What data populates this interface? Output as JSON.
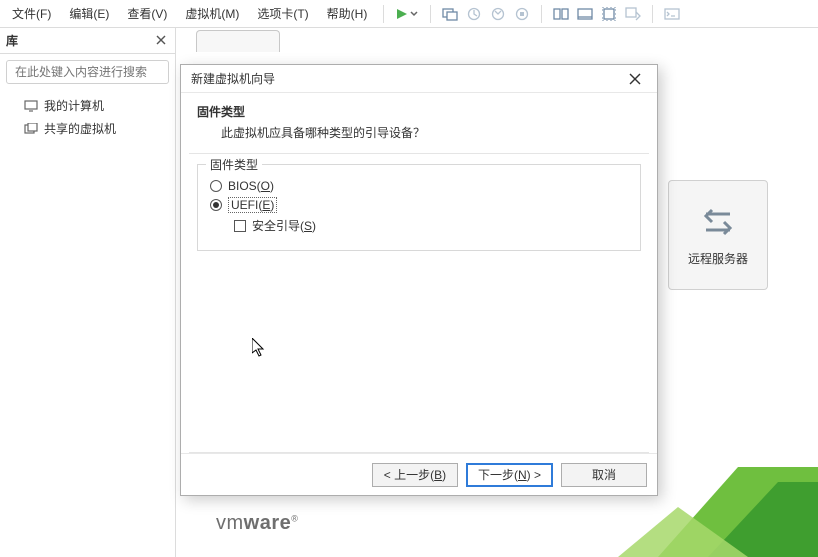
{
  "menubar": {
    "items": [
      {
        "label": "文件(F)"
      },
      {
        "label": "编辑(E)"
      },
      {
        "label": "查看(V)"
      },
      {
        "label": "虚拟机(M)"
      },
      {
        "label": "选项卡(T)"
      },
      {
        "label": "帮助(H)"
      }
    ]
  },
  "sidebar": {
    "title": "库",
    "search_placeholder": "在此处键入内容进行搜索",
    "items": [
      {
        "label": "我的计算机",
        "icon": "monitor"
      },
      {
        "label": "共享的虚拟机",
        "icon": "shared"
      }
    ]
  },
  "side_card": {
    "label": "远程服务器"
  },
  "logo": {
    "thin": "vm",
    "bold": "ware"
  },
  "dialog": {
    "title": "新建虚拟机向导",
    "heading": "固件类型",
    "subheading": "此虚拟机应具备哪种类型的引导设备？",
    "group_label": "固件类型",
    "bios_pre": "BIOS(",
    "bios_u": "O",
    "bios_post": ")",
    "uefi_pre": "UEFI(",
    "uefi_u": "E",
    "uefi_post": ")",
    "secure_pre": "安全引导(",
    "secure_u": "S",
    "secure_post": ")",
    "btn_back_pre": "< 上一步(",
    "btn_back_u": "B",
    "btn_back_post": ")",
    "btn_next_pre": "下一步(",
    "btn_next_u": "N",
    "btn_next_post": ") >",
    "btn_cancel": "取消"
  }
}
